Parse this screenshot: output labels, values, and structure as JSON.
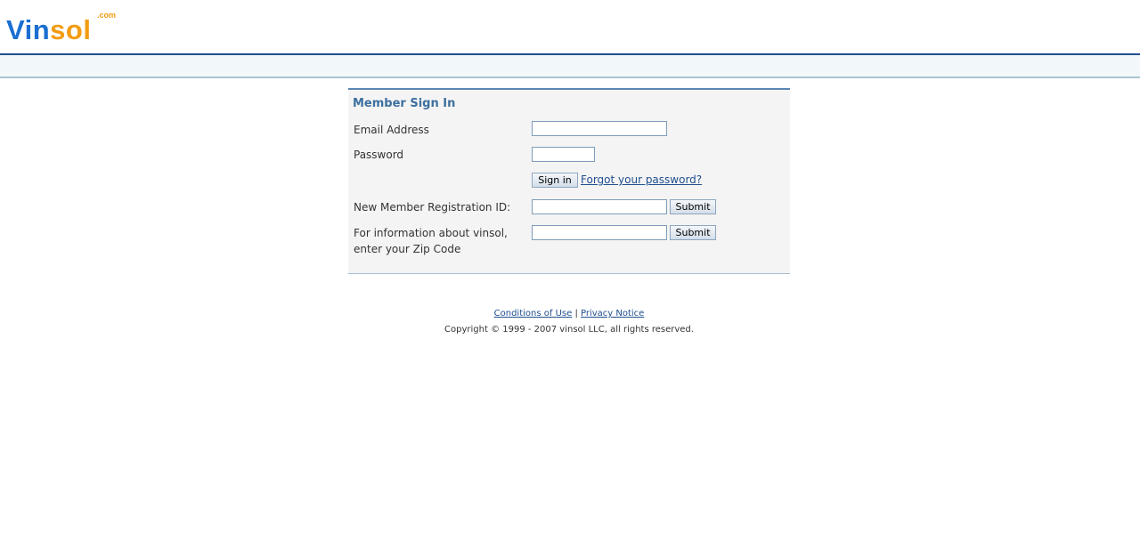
{
  "logo": {
    "part1": "Vin",
    "part2": "sol",
    "suffix": ".com"
  },
  "signin": {
    "title": "Member Sign In",
    "email_label": "Email Address",
    "email_value": "",
    "password_label": "Password",
    "password_value": "",
    "signin_button": "Sign in",
    "forgot_link": "Forgot your password?",
    "registration_label": "New Member Registration ID:",
    "registration_value": "",
    "registration_submit": "Submit",
    "zip_label": "For information about vinsol, enter your Zip Code",
    "zip_value": "",
    "zip_submit": "Submit"
  },
  "footer": {
    "conditions_link": "Conditions of Use",
    "separator": "|",
    "privacy_link": "Privacy Notice",
    "copyright": "Copyright © 1999 - 2007 vinsol LLC, all rights reserved."
  },
  "colors": {
    "brand_blue": "#1a6fd1",
    "brand_orange": "#f39c12",
    "header_rule": "#1f4f8f",
    "panel_title": "#3d6f9f"
  }
}
